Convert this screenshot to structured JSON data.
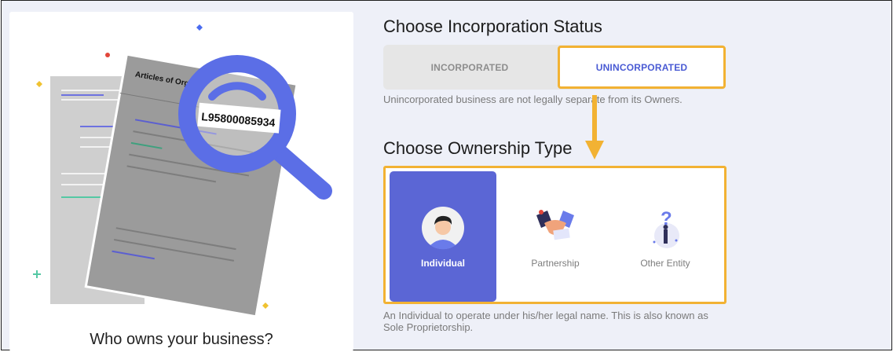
{
  "left": {
    "title": "Who owns your business?",
    "document_heading": "Articles of Org",
    "magnified_number": "L95800085934"
  },
  "incorporation": {
    "heading": "Choose Incorporation Status",
    "options": [
      "INCORPORATED",
      "UNINCORPORATED"
    ],
    "selected": "UNINCORPORATED",
    "description": "Unincorporated business are not legally separate from its Owners."
  },
  "ownership": {
    "heading": "Choose Ownership Type",
    "options": [
      "Individual",
      "Partnership",
      "Other Entity"
    ],
    "selected": "Individual",
    "description": "An Individual to operate under his/her legal name. This is also known as Sole Proprietorship."
  },
  "colors": {
    "accent": "#5b66d5",
    "highlight": "#f2b233",
    "panel_bg": "#eef0f8"
  },
  "icons": [
    "magnifier-icon",
    "document-icon",
    "person-avatar-icon",
    "handshake-icon",
    "question-entity-icon",
    "down-arrow-icon"
  ]
}
